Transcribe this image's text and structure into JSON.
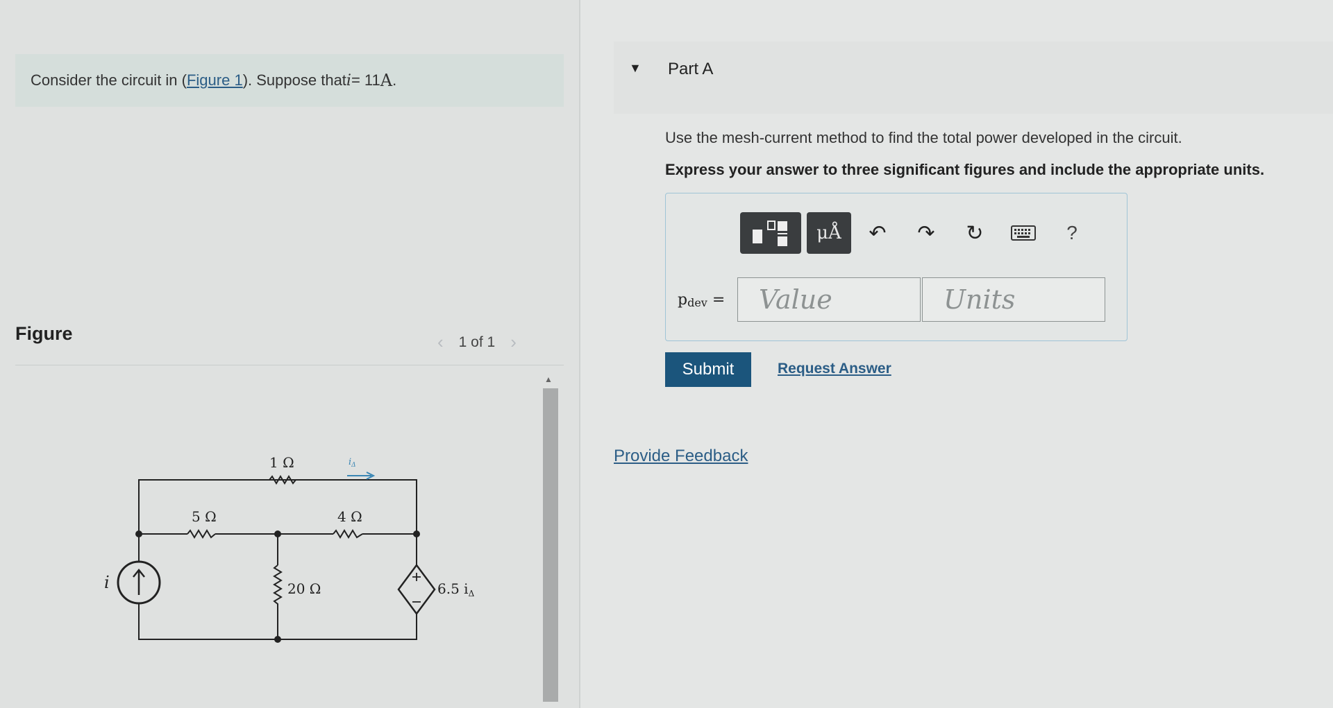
{
  "problem": {
    "prefix": "Consider the circuit in (",
    "figure_link": "Figure 1",
    "middle": "). Suppose that ",
    "var": "i",
    "equals": " = 11 ",
    "unit": "A",
    "suffix": "."
  },
  "figure": {
    "label": "Figure",
    "pager_text": "1 of 1",
    "circuit": {
      "r1": "1 Ω",
      "r5": "5 Ω",
      "r4": "4 Ω",
      "r20": "20 Ω",
      "source_label": "i",
      "dep_source_label": "6.5 i",
      "dep_source_sub": "Δ",
      "current_label": "i",
      "current_sub": "Δ"
    }
  },
  "part": {
    "title": "Part A",
    "instruction": "Use the mesh-current method to find the total power developed in the circuit.",
    "instruction_bold": "Express your answer to three significant figures and include the appropriate units.",
    "toolbar": {
      "units_btn": "μÅ",
      "help": "?"
    },
    "answer": {
      "label_main": "p",
      "label_sub": "dev",
      "label_eq": " =",
      "value_placeholder": "Value",
      "units_placeholder": "Units"
    },
    "submit_label": "Submit",
    "request_label": "Request Answer"
  },
  "feedback_label": "Provide Feedback"
}
